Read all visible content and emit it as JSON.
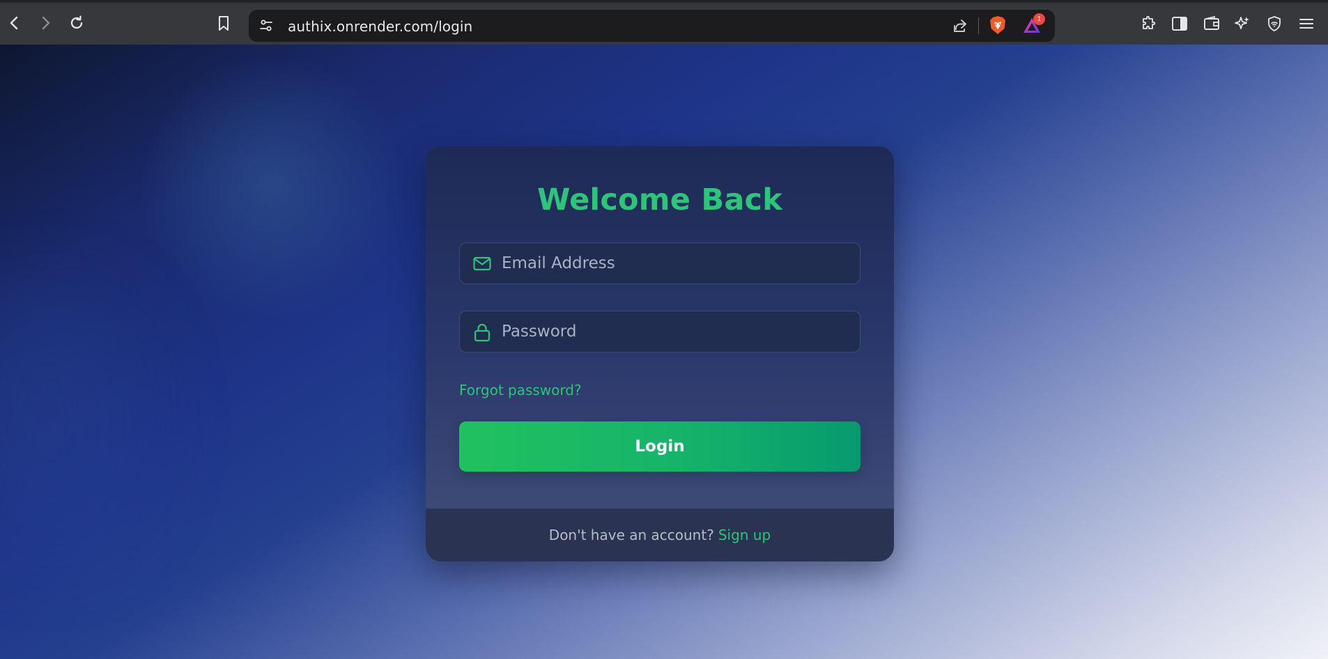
{
  "browser": {
    "url": "authix.onrender.com/login",
    "notification_count": "1"
  },
  "login_card": {
    "title": "Welcome Back",
    "email_placeholder": "Email Address",
    "password_placeholder": "Password",
    "forgot_label": "Forgot password?",
    "login_label": "Login",
    "footer_text": "Don't have an account?",
    "signup_label": "Sign up"
  },
  "colors": {
    "accent": "#2bc678",
    "button_start": "#21c15f",
    "button_end": "#079a6e"
  }
}
